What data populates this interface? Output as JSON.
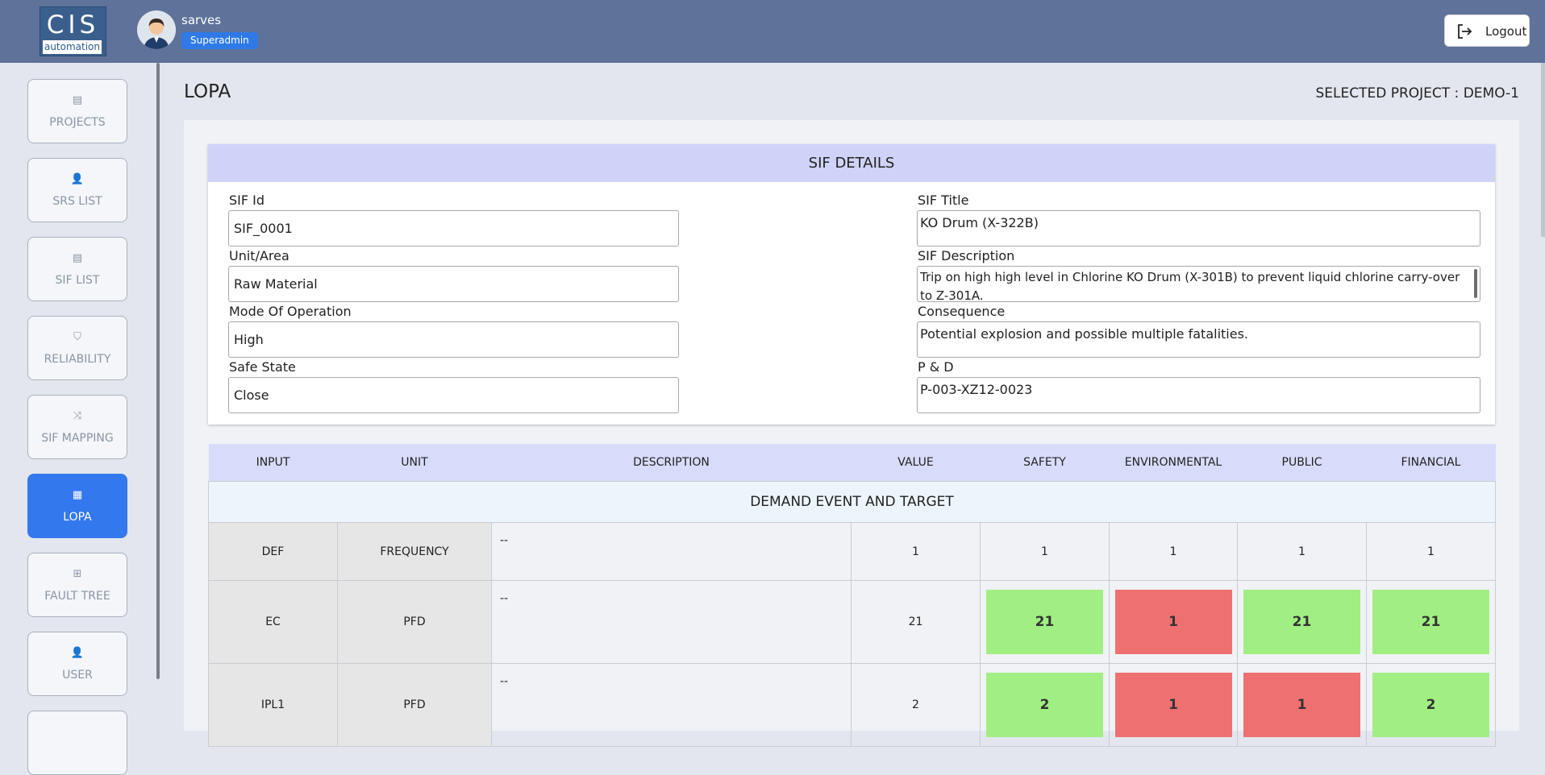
{
  "header": {
    "logo_top": "CIS",
    "logo_bottom": "automation",
    "username": "sarves",
    "role": "Superadmin",
    "logout_label": "Logout"
  },
  "sidebar": {
    "items": [
      {
        "label": "PROJECTS",
        "icon": "list-icon",
        "active": false
      },
      {
        "label": "SRS LIST",
        "icon": "users-list-icon",
        "active": false
      },
      {
        "label": "SIF LIST",
        "icon": "list-icon",
        "active": false
      },
      {
        "label": "RELIABILITY",
        "icon": "shield-check-icon",
        "active": false
      },
      {
        "label": "SIF MAPPING",
        "icon": "shuffle-icon",
        "active": false
      },
      {
        "label": "LOPA",
        "icon": "grid-icon",
        "active": true
      },
      {
        "label": "FAULT TREE",
        "icon": "hierarchy-icon",
        "active": false
      },
      {
        "label": "USER",
        "icon": "user-add-icon",
        "active": false
      }
    ]
  },
  "page": {
    "title": "LOPA",
    "selected_project": "SELECTED PROJECT : DEMO-1"
  },
  "sif_details": {
    "heading": "SIF DETAILS",
    "sif_id": {
      "label": "SIF Id",
      "value": "SIF_0001"
    },
    "unit_area": {
      "label": "Unit/Area",
      "value": "Raw Material"
    },
    "mode": {
      "label": "Mode Of Operation",
      "value": "High"
    },
    "safe_state": {
      "label": "Safe State",
      "value": "Close"
    },
    "sif_title": {
      "label": "SIF Title",
      "value": "KO Drum (X-322B)"
    },
    "sif_description": {
      "label": "SIF Description",
      "value": "Trip on high high level in Chlorine KO Drum (X-301B) to prevent liquid chlorine carry-over to Z-301A."
    },
    "consequence": {
      "label": "Consequence",
      "value": "Potential explosion and possible multiple fatalities."
    },
    "pid": {
      "label": "P & D",
      "value": "P-003-XZ12-0023"
    }
  },
  "lopa": {
    "columns": [
      "INPUT",
      "UNIT",
      "DESCRIPTION",
      "VALUE",
      "SAFETY",
      "ENVIRONMENTAL",
      "PUBLIC",
      "FINANCIAL"
    ],
    "section": "DEMAND EVENT AND TARGET",
    "rows": [
      {
        "input": "DEF",
        "unit": "FREQUENCY",
        "description": "--",
        "value": "1",
        "safety": "1",
        "environmental": "1",
        "public": "1",
        "financial": "1"
      },
      {
        "input": "EC",
        "unit": "PFD",
        "description": "--",
        "value": "21",
        "safety": "21",
        "environmental": "1",
        "public": "21",
        "financial": "21"
      },
      {
        "input": "IPL1",
        "unit": "PFD",
        "description": "--",
        "value": "2",
        "safety": "2",
        "environmental": "1",
        "public": "1",
        "financial": "2"
      }
    ],
    "status_colors": {
      "pass": "#a1ef83",
      "fail": "#ef7070"
    }
  }
}
